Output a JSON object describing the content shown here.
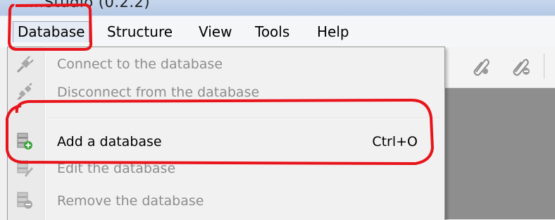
{
  "window": {
    "title": "....Studio (0.2.2)"
  },
  "menubar": {
    "items": [
      {
        "label": "Database",
        "active": true
      },
      {
        "label": "Structure"
      },
      {
        "label": "View"
      },
      {
        "label": "Tools"
      },
      {
        "label": "Help"
      }
    ]
  },
  "dropdown": {
    "items": [
      {
        "label": "Connect to the database",
        "icon": "plug-connect-icon",
        "enabled": false
      },
      {
        "label": "Disconnect from the database",
        "icon": "plug-disconnect-icon",
        "enabled": false
      },
      {
        "label": "Add a database",
        "shortcut": "Ctrl+O",
        "icon": "database-add-icon",
        "enabled": true
      },
      {
        "label": "Edit the database",
        "icon": "database-edit-icon",
        "enabled": false
      },
      {
        "label": "Remove the database",
        "icon": "database-remove-icon",
        "enabled": false
      }
    ]
  },
  "toolbar": {
    "icons": [
      "attachment-add-icon",
      "attachment-remove-icon"
    ]
  },
  "colors": {
    "annotation": "#e8141b",
    "disabled_text": "#8d8d8d",
    "menubar_bg": "#f5f6f7",
    "workspace_bg": "#8e8e8e"
  }
}
